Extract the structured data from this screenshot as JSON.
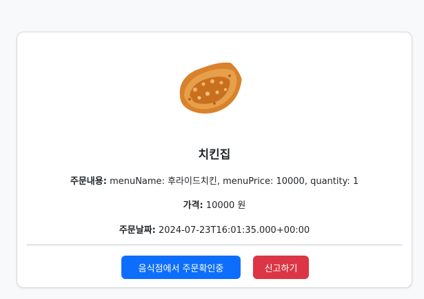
{
  "store": {
    "name": "치킨집",
    "image_icon": "fried-chicken-image"
  },
  "order": {
    "content_label": "주문내용:",
    "content_value": "menuName: 후라이드치킨, menuPrice: 10000, quantity: 1",
    "price_label": "가격:",
    "price_value": "10000 원",
    "date_label": "주문날짜:",
    "date_value": "2024-07-23T16:01:35.000+00:00"
  },
  "actions": {
    "confirm_label": "음식점에서 주문확인중",
    "report_label": "신고하기"
  },
  "colors": {
    "primary": "#0d6efd",
    "danger": "#dc3545",
    "background": "#f8f9fa",
    "card": "#ffffff"
  }
}
